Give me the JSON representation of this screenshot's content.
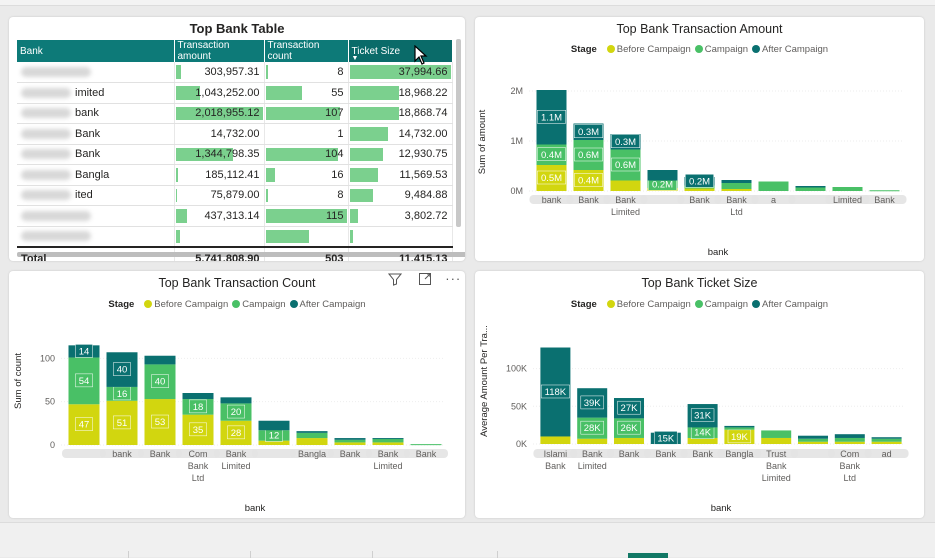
{
  "colors": {
    "before": "#d2d60f",
    "campaign": "#49c066",
    "after": "#0a7070",
    "header_bg": "#0d7a78",
    "databar": "#7bd08e"
  },
  "icons": [
    "filter-icon",
    "focus-mode-icon",
    "more-options-icon",
    "cursor-icon"
  ],
  "legend": {
    "title": "Stage",
    "before": "Before Campaign",
    "campaign": "Campaign",
    "after": "After Campaign"
  },
  "table": {
    "title": "Top Bank Table",
    "headers": {
      "bank": "Bank",
      "amount": "Transaction amount",
      "count": "Transaction count",
      "ticket": "Ticket Size"
    },
    "rows": [
      {
        "bank": "",
        "amount": "303,957.31",
        "count": "8",
        "ticket": "37,994.66",
        "fracA": 0.08,
        "fracC": 0.06,
        "fracT": 1.0
      },
      {
        "bank": "imited",
        "amount": "1,043,252.00",
        "count": "55",
        "ticket": "18,968.22",
        "fracA": 0.3,
        "fracC": 0.46,
        "fracT": 0.5
      },
      {
        "bank": "bank",
        "amount": "2,018,955.12",
        "count": "107",
        "ticket": "18,868.74",
        "fracA": 1.0,
        "fracC": 0.92,
        "fracT": 0.5
      },
      {
        "bank": "Bank",
        "amount": "14,732.00",
        "count": "1",
        "ticket": "14,732.00",
        "fracA": 0.01,
        "fracC": 0.01,
        "fracT": 0.39
      },
      {
        "bank": "Bank",
        "amount": "1,344,798.35",
        "count": "104",
        "ticket": "12,930.75",
        "fracA": 0.67,
        "fracC": 0.9,
        "fracT": 0.34
      },
      {
        "bank": "Bangla",
        "amount": "185,112.41",
        "count": "16",
        "ticket": "11,569.53",
        "fracA": 0.05,
        "fracC": 0.14,
        "fracT": 0.3
      },
      {
        "bank": "ited",
        "amount": "75,879.00",
        "count": "8",
        "ticket": "9,484.88",
        "fracA": 0.03,
        "fracC": 0.06,
        "fracT": 0.25
      },
      {
        "bank": "",
        "amount": "437,313.14",
        "count": "115",
        "ticket": "3,802.72",
        "fracA": 0.15,
        "fracC": 1.0,
        "fracT": 0.1
      },
      {
        "bank": "",
        "amount": "",
        "count": "",
        "ticket": "",
        "fracA": 0.07,
        "fracC": 0.55,
        "fracT": 0.05
      }
    ],
    "total": {
      "label": "Total",
      "amount": "5,741,808.90",
      "count": "503",
      "ticket": "11,415.13"
    }
  },
  "charts": {
    "amount": {
      "title": "Top Bank Transaction Amount",
      "ylabel": "Sum of amount",
      "xlabel": "bank"
    },
    "count": {
      "title": "Top Bank Transaction Count",
      "ylabel": "Sum of count",
      "xlabel": "bank"
    },
    "ticket": {
      "title": "Top Bank Ticket Size",
      "ylabel": "Average Amount Per Tra...",
      "xlabel": "bank"
    }
  },
  "chart_data": [
    {
      "id": "amount",
      "type": "bar",
      "stacked": true,
      "title": "Top Bank Transaction Amount",
      "xlabel": "bank",
      "ylabel": "Sum of amount",
      "ylim": [
        0,
        2000000
      ],
      "yticks": [
        0,
        1000000,
        2000000
      ],
      "ytick_labels": [
        "0M",
        "1M",
        "2M"
      ],
      "categories": [
        [
          "bank"
        ],
        [
          "Bank"
        ],
        [
          "Bank",
          "Limited"
        ],
        [],
        [
          "Bank"
        ],
        [
          "Bank",
          "Ltd"
        ],
        [
          "a"
        ],
        [],
        [
          "Limited"
        ],
        [
          "Bank"
        ]
      ],
      "series": [
        {
          "name": "Before Campaign",
          "values": [
            520000,
            420000,
            210000,
            60000,
            50000,
            40000,
            0,
            0,
            0,
            0
          ],
          "labels": [
            "0.5M",
            "0.4M",
            "",
            "",
            "",
            "",
            "",
            "",
            "",
            ""
          ]
        },
        {
          "name": "Campaign",
          "values": [
            410000,
            600000,
            620000,
            150000,
            60000,
            120000,
            190000,
            70000,
            80000,
            15000
          ],
          "labels": [
            "0.4M",
            "0.6M",
            "0.6M",
            "0.2M",
            "",
            "",
            "",
            "",
            "",
            ""
          ]
        },
        {
          "name": "After Campaign",
          "values": [
            1090000,
            330000,
            310000,
            210000,
            170000,
            60000,
            0,
            30000,
            0,
            0
          ],
          "labels": [
            "1.1M",
            "0.3M",
            "0.3M",
            "",
            "0.2M",
            "",
            "",
            "",
            "",
            ""
          ]
        }
      ]
    },
    {
      "id": "count",
      "type": "bar",
      "stacked": true,
      "title": "Top Bank Transaction Count",
      "xlabel": "bank",
      "ylabel": "Sum of count",
      "ylim": [
        0,
        120
      ],
      "yticks": [
        0,
        50,
        100
      ],
      "ytick_labels": [
        "0",
        "50",
        "100"
      ],
      "categories": [
        [],
        [
          "bank"
        ],
        [
          "Bank"
        ],
        [
          "Com",
          "Bank",
          "Ltd"
        ],
        [
          "Bank",
          "Limited"
        ],
        [],
        [
          "Bangla"
        ],
        [
          "Bank"
        ],
        [
          "Bank",
          "Limited"
        ],
        [
          "Bank"
        ]
      ],
      "series": [
        {
          "name": "Before Campaign",
          "values": [
            47,
            51,
            53,
            35,
            28,
            5,
            8,
            3,
            3,
            0
          ],
          "labels": [
            "47",
            "51",
            "53",
            "35",
            "28",
            "",
            "",
            "",
            "",
            ""
          ]
        },
        {
          "name": "Campaign",
          "values": [
            54,
            16,
            40,
            18,
            20,
            12,
            6,
            3,
            4,
            1
          ],
          "labels": [
            "54",
            "16",
            "40",
            "18",
            "20",
            "12",
            "",
            "",
            "",
            ""
          ]
        },
        {
          "name": "After Campaign",
          "values": [
            14,
            40,
            10,
            7,
            7,
            11,
            2,
            2,
            1,
            0
          ],
          "labels": [
            "14",
            "40",
            "",
            "",
            "",
            "",
            "",
            "",
            "",
            ""
          ]
        }
      ]
    },
    {
      "id": "ticket",
      "type": "bar",
      "stacked": true,
      "title": "Top Bank Ticket Size",
      "xlabel": "bank",
      "ylabel": "Average Amount Per Tra...",
      "ylim": [
        0,
        130000
      ],
      "yticks": [
        0,
        50000,
        100000
      ],
      "ytick_labels": [
        "0K",
        "50K",
        "100K"
      ],
      "categories": [
        [
          "Islami",
          "Bank"
        ],
        [
          "Bank",
          "Limited"
        ],
        [
          "Bank"
        ],
        [
          "Bank"
        ],
        [
          "Bank"
        ],
        [
          "Bangla"
        ],
        [
          "Trust",
          "Bank",
          "Limited"
        ],
        [],
        [
          "Com",
          "Bank",
          "Ltd"
        ],
        [
          "ad"
        ]
      ],
      "series": [
        {
          "name": "Before Campaign",
          "values": [
            10000,
            7000,
            8000,
            0,
            8000,
            19000,
            8000,
            3000,
            3000,
            3000
          ],
          "labels": [
            "",
            "",
            "",
            "",
            "",
            "19K",
            "",
            "",
            "",
            ""
          ]
        },
        {
          "name": "Campaign",
          "values": [
            0,
            28000,
            26000,
            0,
            14000,
            3000,
            10000,
            4000,
            5000,
            4000
          ],
          "labels": [
            "",
            "28K",
            "26K",
            "",
            "14K",
            "",
            "",
            "",
            "",
            ""
          ]
        },
        {
          "name": "After Campaign",
          "values": [
            118000,
            39000,
            27000,
            15000,
            31000,
            2000,
            0,
            4000,
            5000,
            2000
          ],
          "labels": [
            "118K",
            "39K",
            "27K",
            "15K",
            "31K",
            "",
            "",
            "",
            "",
            ""
          ]
        }
      ]
    }
  ]
}
